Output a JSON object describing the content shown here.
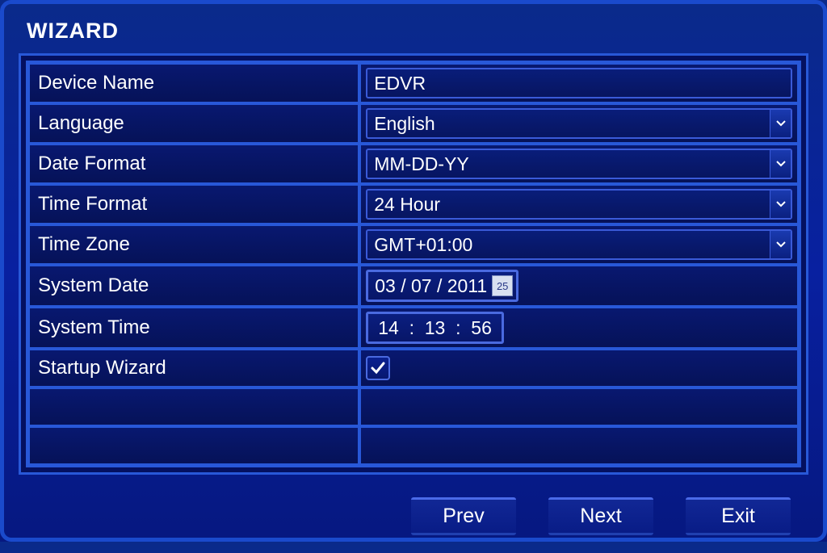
{
  "window": {
    "title": "WIZARD"
  },
  "form": {
    "device_name": {
      "label": "Device Name",
      "value": "EDVR"
    },
    "language": {
      "label": "Language",
      "value": "English"
    },
    "date_format": {
      "label": "Date Format",
      "value": "MM-DD-YY"
    },
    "time_format": {
      "label": "Time Format",
      "value": "24 Hour"
    },
    "time_zone": {
      "label": "Time Zone",
      "value": "GMT+01:00"
    },
    "system_date": {
      "label": "System Date",
      "value": "03 / 07 / 2011",
      "icon_text": "25"
    },
    "system_time": {
      "label": "System Time",
      "value": "14  :  13  :  56"
    },
    "startup_wizard": {
      "label": "Startup Wizard",
      "checked": true
    }
  },
  "buttons": {
    "prev": "Prev",
    "next": "Next",
    "exit": "Exit"
  }
}
